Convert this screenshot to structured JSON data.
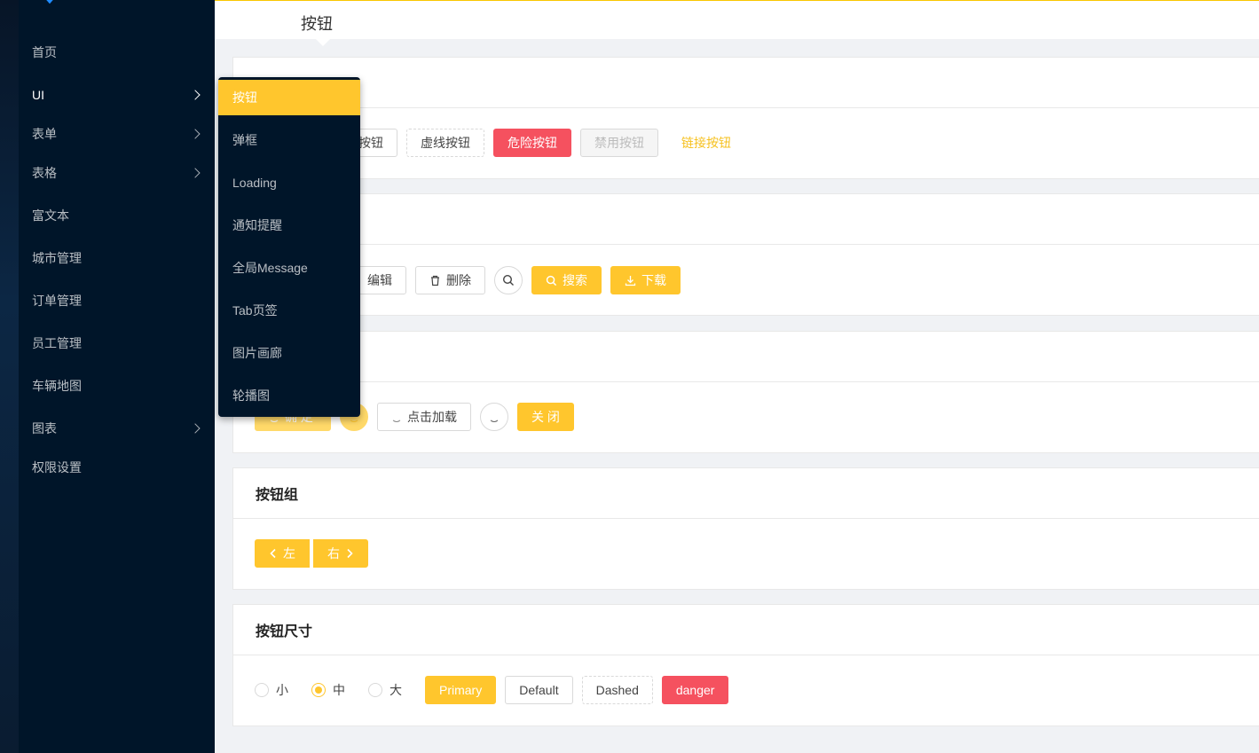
{
  "breadcrumb": "按钮",
  "sidebar": {
    "items": [
      {
        "label": "首页",
        "has_children": false
      },
      {
        "label": "UI",
        "has_children": true
      },
      {
        "label": "表单",
        "has_children": true
      },
      {
        "label": "表格",
        "has_children": true
      },
      {
        "label": "富文本",
        "has_children": false
      },
      {
        "label": "城市管理",
        "has_children": false
      },
      {
        "label": "订单管理",
        "has_children": false
      },
      {
        "label": "员工管理",
        "has_children": false
      },
      {
        "label": "车辆地图",
        "has_children": false
      },
      {
        "label": "图表",
        "has_children": true
      },
      {
        "label": "权限设置",
        "has_children": false
      }
    ]
  },
  "submenu": {
    "items": [
      "按钮",
      "弹框",
      "Loading",
      "通知提醒",
      "全局Message",
      "Tab页签",
      "图片画廊",
      "轮播图"
    ],
    "selected": "按钮"
  },
  "card1": {
    "partial_button": "按钮",
    "dashed_button": "虚线按钮",
    "danger_button": "危险按钮",
    "disabled_button": "禁用按钮",
    "link_button": "链接按钮"
  },
  "card2": {
    "edit_button": "编辑",
    "delete_button": "删除",
    "search_button": "搜索",
    "download_button": "下载"
  },
  "card3": {
    "confirm_button": "确 定",
    "click_load_button": "点击加载",
    "close_button": "关 闭"
  },
  "card4": {
    "title": "按钮组",
    "left_button": "左",
    "right_button": "右"
  },
  "card5": {
    "title": "按钮尺寸",
    "sizes": [
      "小",
      "中",
      "大"
    ],
    "selected_size": "中",
    "primary": "Primary",
    "default": "Default",
    "dashed": "Dashed",
    "danger": "danger"
  },
  "colors": {
    "primary": "#ffc62d",
    "danger": "#f5515f",
    "sidebar": "#001529"
  }
}
